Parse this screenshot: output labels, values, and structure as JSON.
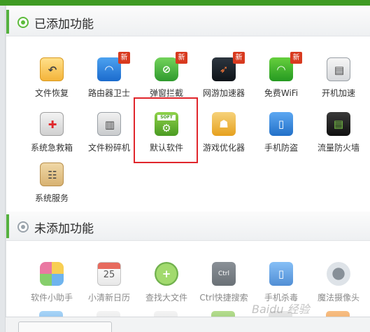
{
  "sections": {
    "added": {
      "title": "已添加功能",
      "items": [
        {
          "label": "文件恢复",
          "icon": "folder-restore-icon",
          "badge": ""
        },
        {
          "label": "路由器卫士",
          "icon": "router-guard-icon",
          "badge": "新"
        },
        {
          "label": "弹窗拦截",
          "icon": "popup-block-icon",
          "badge": "新"
        },
        {
          "label": "网游加速器",
          "icon": "rocket-icon",
          "badge": "新"
        },
        {
          "label": "免费WiFi",
          "icon": "wifi-icon",
          "badge": "新"
        },
        {
          "label": "开机加速",
          "icon": "boot-speedup-icon",
          "badge": ""
        },
        {
          "label": "系统急救箱",
          "icon": "first-aid-kit-icon",
          "badge": ""
        },
        {
          "label": "文件粉碎机",
          "icon": "file-shredder-icon",
          "badge": ""
        },
        {
          "label": "默认软件",
          "icon": "default-software-icon",
          "badge": ""
        },
        {
          "label": "游戏优化器",
          "icon": "game-optimizer-icon",
          "badge": ""
        },
        {
          "label": "手机防盗",
          "icon": "phone-antitheft-icon",
          "badge": ""
        },
        {
          "label": "流量防火墙",
          "icon": "traffic-firewall-icon",
          "badge": ""
        },
        {
          "label": "系统服务",
          "icon": "system-service-icon",
          "badge": ""
        }
      ]
    },
    "not_added": {
      "title": "未添加功能",
      "items": [
        {
          "label": "软件小助手",
          "icon": "software-helper-icon"
        },
        {
          "label": "小清新日历",
          "icon": "calendar-icon",
          "date": "25"
        },
        {
          "label": "查找大文件",
          "icon": "find-large-file-icon"
        },
        {
          "label": "Ctrl快捷搜索",
          "icon": "ctrl-key-icon",
          "key": "Ctrl"
        },
        {
          "label": "手机杀毒",
          "icon": "phone-antivirus-icon"
        },
        {
          "label": "魔法摄像头",
          "icon": "webcam-icon"
        }
      ]
    }
  },
  "watermark": "Baidu 经验"
}
